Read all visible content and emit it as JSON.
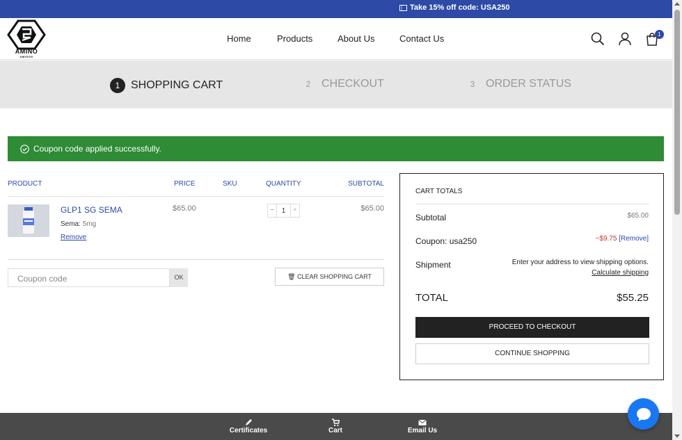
{
  "promo": {
    "text": "Take 15% off code: USA250"
  },
  "brand": {
    "name": "AMINO",
    "sub": "AMIGOS"
  },
  "nav": {
    "items": [
      "Home",
      "Products",
      "About Us",
      "Contact Us"
    ]
  },
  "cart_icon": {
    "badge": "1"
  },
  "steps": [
    {
      "num": "1",
      "label": "SHOPPING CART"
    },
    {
      "num": "2",
      "label": "CHECKOUT"
    },
    {
      "num": "3",
      "label": "ORDER STATUS"
    }
  ],
  "alert": {
    "text": "Coupon code applied successfully."
  },
  "table": {
    "headers": {
      "product": "PRODUCT",
      "price": "PRICE",
      "sku": "SKU",
      "quantity": "QUANTITY",
      "subtotal": "SUBTOTAL"
    },
    "item": {
      "name": "GLP1 SG SEMA",
      "variation_label": "Sema:",
      "variation_value": "5mg",
      "remove": "Remove",
      "price": "$65.00",
      "qty_minus": "−",
      "qty": "1",
      "qty_plus": "+",
      "subtotal": "$65.00"
    }
  },
  "coupon": {
    "placeholder": "Coupon code",
    "ok": "OK"
  },
  "clear_cart": "CLEAR SHOPPING CART",
  "totals": {
    "title": "CART TOTALS",
    "subtotal_label": "Subtotal",
    "subtotal_value": "$65.00",
    "coupon_label": "Coupon: usa250",
    "coupon_value": "−$9.75",
    "coupon_remove": "[Remove]",
    "shipment_label": "Shipment",
    "shipment_text": "Enter your address to view shipping options.",
    "calc_shipping": "Calculate shipping",
    "total_label": "TOTAL",
    "total_value": "$55.25",
    "checkout": "PROCEED TO CHECKOUT",
    "continue": "CONTINUE SHOPPING"
  },
  "bottom_bar": {
    "certificates": "Certificates",
    "cart": "Cart",
    "email": "Email Us"
  },
  "colors": {
    "brand_blue": "#2c4aa6",
    "success_green": "#2e8b36",
    "dark": "#222222",
    "discount_red": "#c0392b"
  }
}
